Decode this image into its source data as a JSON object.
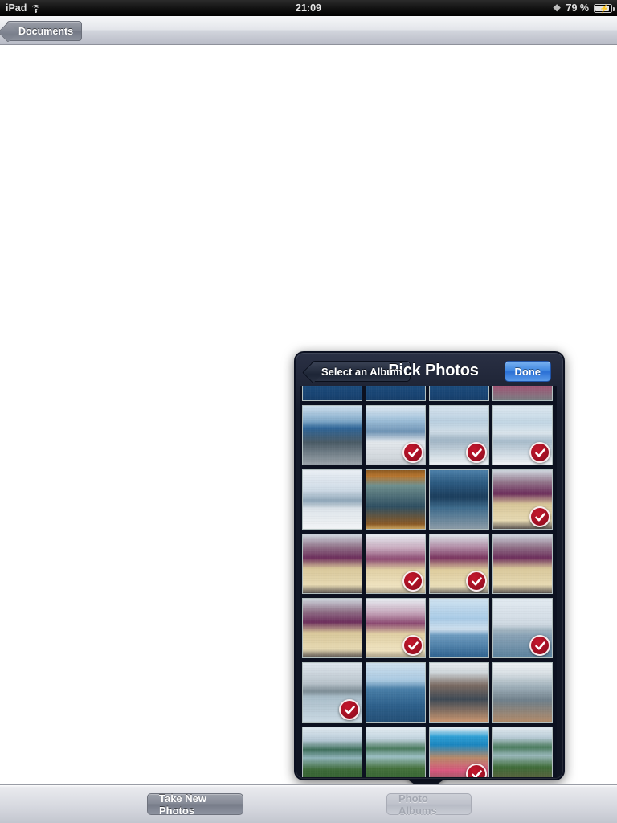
{
  "status_bar": {
    "carrier": "iPad",
    "wifi_icon": "wifi-icon",
    "time": "21:09",
    "bluetooth_icon": "bluetooth-icon",
    "battery_percent": "79 %",
    "battery_icon": "battery-charging-icon"
  },
  "navbar": {
    "back_label": "Documents"
  },
  "toolbar": {
    "take_new_photos_label": "Take New Photos",
    "photo_albums_label": "Photo Albums",
    "photo_albums_disabled": true
  },
  "popover": {
    "back_label": "Select an Album",
    "title": "Pick Photos",
    "done_label": "Done",
    "accent_color": "#3d85e0",
    "selection_badge_color": "#9c0f22",
    "chrome_color": "#131a2a"
  },
  "grid": {
    "columns": 4,
    "selected_count": 11,
    "photos": [
      {
        "id": "p01",
        "desc": "ocean-horizon",
        "style": "p-ocean",
        "selected": false
      },
      {
        "id": "p02",
        "desc": "ocean-horizon",
        "style": "p-ocean",
        "selected": false
      },
      {
        "id": "p03",
        "desc": "ocean-horizon",
        "style": "p-ocean",
        "selected": false
      },
      {
        "id": "p04",
        "desc": "deck-pink-dress",
        "style": "p-pinkdeck",
        "selected": false
      },
      {
        "id": "p05",
        "desc": "passengers-at-rail-blue-sea",
        "style": "p-deck",
        "selected": false
      },
      {
        "id": "p06",
        "desc": "family-on-deck",
        "style": "p-shipwalk",
        "selected": true
      },
      {
        "id": "p07",
        "desc": "kite-over-ship-bow",
        "style": "p-kite",
        "selected": true
      },
      {
        "id": "p08",
        "desc": "kite-over-ship-bow-2",
        "style": "p-kite2",
        "selected": true
      },
      {
        "id": "p09",
        "desc": "man-on-ship-walkway",
        "style": "p-sky-rail",
        "selected": false
      },
      {
        "id": "p10",
        "desc": "whale-mural",
        "style": "p-whale",
        "selected": false
      },
      {
        "id": "p11",
        "desc": "orca-display",
        "style": "p-orca",
        "selected": false
      },
      {
        "id": "p12",
        "desc": "hula-dancers-lounge",
        "style": "p-hula",
        "selected": true
      },
      {
        "id": "p13",
        "desc": "hula-dancers-group",
        "style": "p-hula",
        "selected": false
      },
      {
        "id": "p14",
        "desc": "hula-dancer-solo",
        "style": "p-hula2",
        "selected": true
      },
      {
        "id": "p15",
        "desc": "hula-dancers-pair",
        "style": "p-hula3",
        "selected": true
      },
      {
        "id": "p16",
        "desc": "hula-dancers-window",
        "style": "p-hula",
        "selected": false
      },
      {
        "id": "p17",
        "desc": "hula-dancers-line",
        "style": "p-hula",
        "selected": false
      },
      {
        "id": "p18",
        "desc": "hula-dancers-line-2",
        "style": "p-hula2",
        "selected": true
      },
      {
        "id": "p19",
        "desc": "parasailing-over-sea",
        "style": "p-parasail",
        "selected": false
      },
      {
        "id": "p20",
        "desc": "city-skyline-from-water",
        "style": "p-skyline",
        "selected": true
      },
      {
        "id": "p21",
        "desc": "coastal-city-hills",
        "style": "p-city",
        "selected": true
      },
      {
        "id": "p22",
        "desc": "open-sea",
        "style": "p-sea",
        "selected": false
      },
      {
        "id": "p23",
        "desc": "crowd-indoor-activity",
        "style": "p-cabin",
        "selected": false
      },
      {
        "id": "p24",
        "desc": "ship-lounge-crowd",
        "style": "p-lounge",
        "selected": false
      },
      {
        "id": "p25",
        "desc": "hanauma-bay-overlook",
        "style": "p-bay",
        "selected": false
      },
      {
        "id": "p26",
        "desc": "hanauma-bay-overlook-2",
        "style": "p-bay2",
        "selected": false
      },
      {
        "id": "p27",
        "desc": "girl-under-blue-umbrella",
        "style": "p-umbrella",
        "selected": true
      },
      {
        "id": "p28",
        "desc": "hiker-at-bay-overlook",
        "style": "p-hiker",
        "selected": false
      }
    ]
  }
}
